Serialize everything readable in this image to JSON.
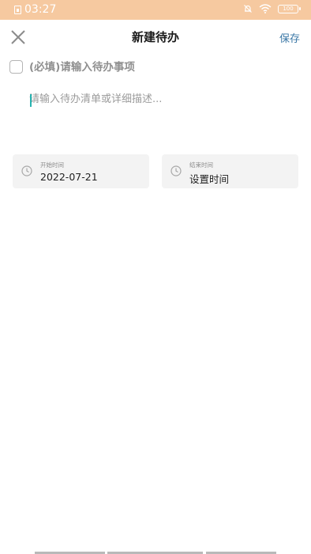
{
  "status_bar": {
    "time": "03:27",
    "battery_label": "100"
  },
  "nav": {
    "title": "新建待办",
    "save_label": "保存",
    "close_icon": "close-icon"
  },
  "form": {
    "title_placeholder": "(必填)请输入待办事项",
    "description_placeholder": "请输入待办清单或详细描述..."
  },
  "time_cards": {
    "start": {
      "caption": "开始时间",
      "value": "2022-07-21",
      "icon": "clock-icon"
    },
    "end": {
      "caption": "结束时间",
      "value": "设置时间",
      "icon": "clock-icon"
    }
  },
  "colors": {
    "status_bar": "#f6c9a0",
    "accent": "#3a77a6",
    "cursor": "#27b3b0",
    "card_bg": "#f3f3f3"
  }
}
